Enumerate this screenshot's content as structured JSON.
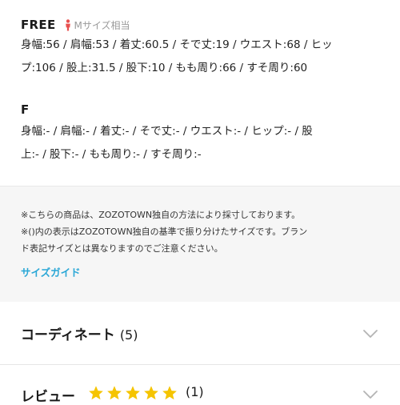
{
  "sizes": [
    {
      "name": "FREE",
      "note": "Mサイズ相当",
      "measure_lines": [
        "身幅:56 / 肩幅:53 / 着丈:60.5 / そで丈:19 / ウエスト:68 / ヒッ",
        "プ:106 / 股上:31.5 / 股下:10 / もも周り:66 / すそ周り:60"
      ]
    },
    {
      "name": "F",
      "measure_lines": [
        "身幅:- / 肩幅:- / 着丈:- / そで丈:- / ウエスト:- / ヒップ:- / 股",
        "上:- / 股下:- / もも周り:- / すそ周り:-"
      ]
    }
  ],
  "notes": {
    "note1": "※こちらの商品は、ZOZOTOWN独自の方法により採寸しております。",
    "note2_line1": "※()内の表示はZOZOTOWN独自の基準で振り分けたサイズです。ブラン",
    "note2_line2": "ド表記サイズとは異なりますのでご注意ください。",
    "size_guide_label": "サイズガイド"
  },
  "accordions": {
    "coordinate": {
      "label": "コーディネート",
      "count": "(5)"
    },
    "review": {
      "label": "レビュー",
      "rating": 5,
      "max_rating": 5,
      "count": "(1)"
    }
  },
  "colors": {
    "link": "#2aa7d6",
    "star": "#f5c400",
    "person_icon": "#e8504f",
    "notes_bg": "#f6f6f6"
  },
  "icons": {
    "size_note_icon": "person-icon",
    "accordion_icon": "chevron-down-icon",
    "rating_icon": "star-icon"
  }
}
